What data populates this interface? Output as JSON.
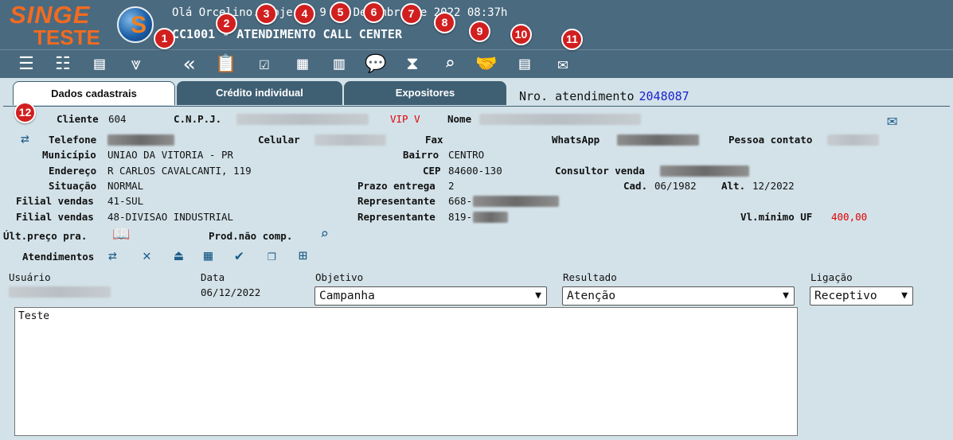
{
  "header": {
    "logo_line1": "SINGE",
    "logo_line2": "TESTE",
    "greeting": "Olá Orcelino. Hoje 6/ 9 de Dezembro de 2022 08:37h",
    "screen_title": "CC1001 - ATENDIMENTO CALL CENTER"
  },
  "toolbar": {
    "badges": [
      "1",
      "2",
      "3",
      "4",
      "5",
      "6",
      "7",
      "8",
      "9",
      "10",
      "11",
      "12"
    ]
  },
  "tabs": [
    {
      "label": "Dados cadastrais"
    },
    {
      "label": "Crédito individual"
    },
    {
      "label": "Expositores"
    }
  ],
  "atendimento": {
    "label": "Nro. atendimento",
    "value": "2048087"
  },
  "form": {
    "cliente_label": "Cliente",
    "cliente_value": "604",
    "cnpj_label": "C.N.P.J.",
    "vip": "VIP V",
    "nome_label": "Nome",
    "telefone_label": "Telefone",
    "celular_label": "Celular",
    "fax_label": "Fax",
    "whatsapp_label": "WhatsApp",
    "pessoa_contato_label": "Pessoa contato",
    "municipio_label": "Município",
    "municipio_value": "UNIAO DA VITORIA - PR",
    "bairro_label": "Bairro",
    "bairro_value": "CENTRO",
    "endereco_label": "Endereço",
    "endereco_value": "R CARLOS CAVALCANTI, 119",
    "cep_label": "CEP",
    "cep_value": "84600-130",
    "consultor_label": "Consultor venda",
    "situacao_label": "Situação",
    "situacao_value": "NORMAL",
    "prazo_label": "Prazo entrega",
    "prazo_value": "2",
    "cad_label": "Cad.",
    "cad_value": "06/1982",
    "alt_label": "Alt.",
    "alt_value": "12/2022",
    "filial1_label": "Filial vendas",
    "filial1_value": "41-SUL",
    "representante1_label": "Representante",
    "representante1_value": "668-",
    "filial2_label": "Filial vendas",
    "filial2_value": "48-DIVISAO INDUSTRIAL",
    "representante2_label": "Representante",
    "representante2_value": "819-",
    "vlminimo_label": "Vl.mínimo UF",
    "vlminimo_value": "400,00",
    "ultpreco_label": "Últ.preço pra.",
    "prodnaocomp_label": "Prod.não comp.",
    "atendimentos_label": "Atendimentos"
  },
  "grid": {
    "usuario_label": "Usuário",
    "data_label": "Data",
    "data_value": "06/12/2022",
    "objetivo_label": "Objetivo",
    "objetivo_value": "Campanha",
    "resultado_label": "Resultado",
    "resultado_value": "Atenção",
    "ligacao_label": "Ligação",
    "ligacao_value": "Receptivo",
    "notes": "Teste"
  },
  "colors": {
    "header_bg": "#4a6a7f",
    "logo": "#f26b21",
    "badge": "#d11f1f",
    "value_blue": "#1a22d0",
    "vip": "#e00000"
  }
}
